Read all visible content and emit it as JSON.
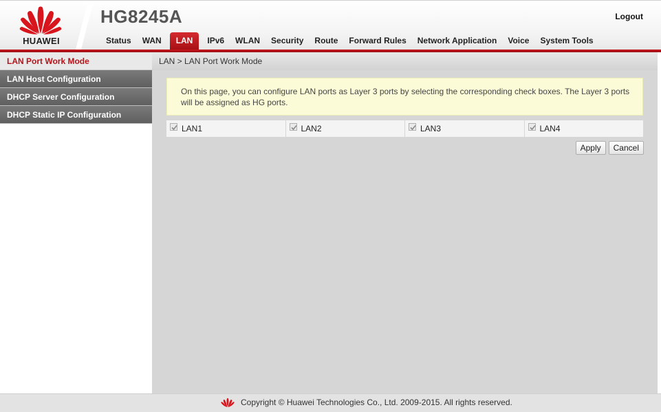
{
  "app": {
    "brand": "HUAWEI",
    "product": "HG8245A",
    "logout_label": "Logout",
    "brand_color": "#c8161d"
  },
  "nav": {
    "tabs": [
      {
        "label": "Status"
      },
      {
        "label": "WAN"
      },
      {
        "label": "LAN",
        "active": true
      },
      {
        "label": "IPv6"
      },
      {
        "label": "WLAN"
      },
      {
        "label": "Security"
      },
      {
        "label": "Route"
      },
      {
        "label": "Forward Rules"
      },
      {
        "label": "Network Application"
      },
      {
        "label": "Voice"
      },
      {
        "label": "System Tools"
      }
    ]
  },
  "sidebar": {
    "items": [
      {
        "label": "LAN Port Work Mode",
        "active": true
      },
      {
        "label": "LAN Host Configuration"
      },
      {
        "label": "DHCP Server Configuration"
      },
      {
        "label": "DHCP Static IP Configuration"
      }
    ]
  },
  "main": {
    "breadcrumb": "LAN > LAN Port Work Mode",
    "notice": "On this page, you can configure LAN ports as Layer 3 ports by selecting the corresponding check boxes. The Layer 3 ports will be assigned as HG ports.",
    "ports": [
      {
        "label": "LAN1",
        "checked": true
      },
      {
        "label": "LAN2",
        "checked": true
      },
      {
        "label": "LAN3",
        "checked": true
      },
      {
        "label": "LAN4",
        "checked": true
      }
    ],
    "apply_label": "Apply",
    "cancel_label": "Cancel"
  },
  "footer": {
    "copyright": "Copyright © Huawei Technologies Co., Ltd. 2009-2015. All rights reserved."
  }
}
